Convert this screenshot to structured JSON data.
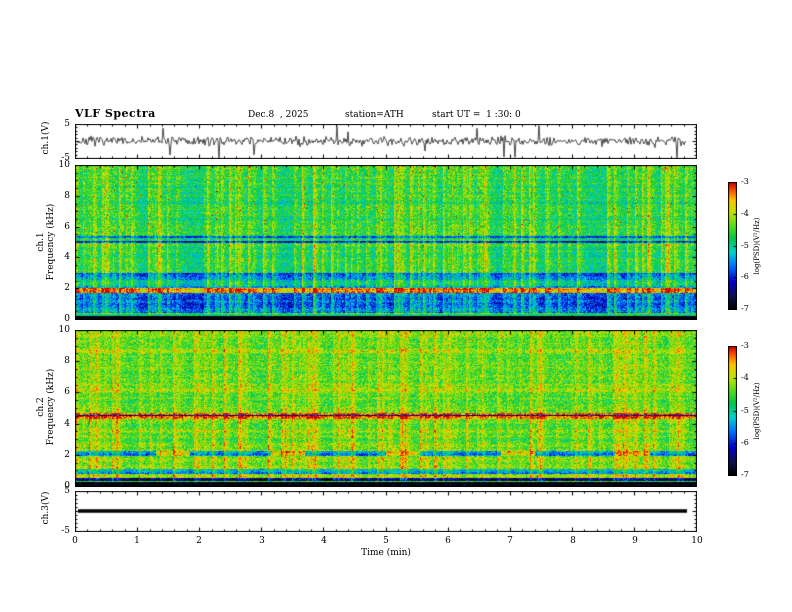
{
  "header": {
    "title": "VLF  Spectra",
    "date": "Dec.8  , 2025",
    "station": "station=ATH",
    "start_ut": "start UT =  1 :30: 0"
  },
  "xaxis": {
    "label": "Time (min)",
    "min": 0,
    "max": 10,
    "ticks": [
      0,
      1,
      2,
      3,
      4,
      5,
      6,
      7,
      8,
      9,
      10
    ]
  },
  "colorbar": {
    "label": "log(PSD)(V²/Hz)",
    "min": -7,
    "max": -3,
    "ticks": [
      -3,
      -4,
      -5,
      -6,
      -7
    ]
  },
  "chart_data": [
    {
      "type": "line",
      "panel": "ch1-waveform",
      "ylabel": "ch.1(V)",
      "ymin": -5,
      "ymax": 5,
      "yticks": [
        5,
        -5
      ],
      "x_minutes": [
        0,
        9.85
      ],
      "description": "Broadband atmospheric noise around 0 V with frequent impulsive sferic spikes reaching +/-5 V",
      "noise_amplitude_v": 1.1,
      "spike_probability": 0.02,
      "spike_amplitude_v": [
        2.5,
        5
      ]
    },
    {
      "type": "heatmap",
      "panel": "ch1-spectrogram",
      "ylabel": "ch.1",
      "ylabel2": "Frequency (kHz)",
      "ymin": 0,
      "ymax": 10,
      "yticks": [
        0,
        2,
        4,
        6,
        8,
        10
      ],
      "tmin": 0,
      "tmax": 10,
      "psd_min": -7,
      "psd_max": -3,
      "base_psd": -4.9,
      "bands": [
        {
          "f_lo": 0.0,
          "f_hi": 0.25,
          "psd": -7.0,
          "note": "black noise floor strip"
        },
        {
          "f_lo": 0.4,
          "f_hi": 3.0,
          "psd": -5.9,
          "note": "blue striped low-frequency region"
        },
        {
          "f_lo": 1.75,
          "f_hi": 2.05,
          "psd": -3.9,
          "note": "bright emission band near 2 kHz"
        },
        {
          "f_lo": 2.2,
          "f_hi": 2.55,
          "psd": -5.3,
          "note": "cyan band"
        },
        {
          "f_lo": 4.95,
          "f_hi": 5.12,
          "psd": -6.2,
          "note": "dark hum line at 5 kHz"
        },
        {
          "f_lo": 5.3,
          "f_hi": 5.42,
          "psd": -5.9,
          "note": "second dark hum line"
        }
      ],
      "streaks": {
        "per_min": 9,
        "psd_boost": 1.5,
        "note": "vertical broadband sferic streaks"
      },
      "speckles": {
        "f_lo": 5.5,
        "f_hi": 10,
        "psd": -3.2,
        "note": "red speckles in upper band"
      }
    },
    {
      "type": "heatmap",
      "panel": "ch2-spectrogram",
      "ylabel": "ch.2",
      "ylabel2": "Frequency (kHz)",
      "ymin": 0,
      "ymax": 10,
      "yticks": [
        0,
        2,
        4,
        6,
        8,
        10
      ],
      "tmin": 0,
      "tmax": 10,
      "psd_min": -7,
      "psd_max": -3,
      "base_psd": -4.45,
      "bands": [
        {
          "f_lo": 0.0,
          "f_hi": 0.3,
          "psd": -7.0,
          "note": "black noise floor strip"
        },
        {
          "f_lo": 0.35,
          "f_hi": 0.55,
          "psd": -6.5,
          "note": "dark band"
        },
        {
          "f_lo": 0.55,
          "f_hi": 0.72,
          "psd": -4.2,
          "note": "green row"
        },
        {
          "f_lo": 0.8,
          "f_hi": 1.15,
          "psd": -5.5,
          "note": "darker rows"
        },
        {
          "f_lo": 1.95,
          "f_hi": 2.25,
          "psd": -4.0,
          "dash_psd": -5.7,
          "dash_period_min": 1.85,
          "dash_fill": 0.7,
          "note": "dashed band near 2 kHz"
        },
        {
          "f_lo": 4.35,
          "f_hi": 4.72,
          "psd": -3.5,
          "note": "strong red band near 4.5 kHz"
        },
        {
          "f_lo": 4.5,
          "f_hi": 4.58,
          "psd": -6.8,
          "note": "dark core line inside red band"
        }
      ],
      "streaks": {
        "per_min": 8,
        "psd_boost": 1.1,
        "note": "vertical sferic streaks"
      },
      "speckles": {
        "f_lo": 6,
        "f_hi": 10,
        "psd": -3.4,
        "note": "orange speckles"
      }
    },
    {
      "type": "line",
      "panel": "ch3-flat",
      "ylabel": "ch.3(V)",
      "ymin": -5,
      "ymax": 5,
      "yticks": [
        5,
        -5
      ],
      "x_minutes": [
        0,
        9.85
      ],
      "description": "Channel 3 constant 0 V (no signal) drawn as thick black line",
      "value_v": 0
    }
  ]
}
